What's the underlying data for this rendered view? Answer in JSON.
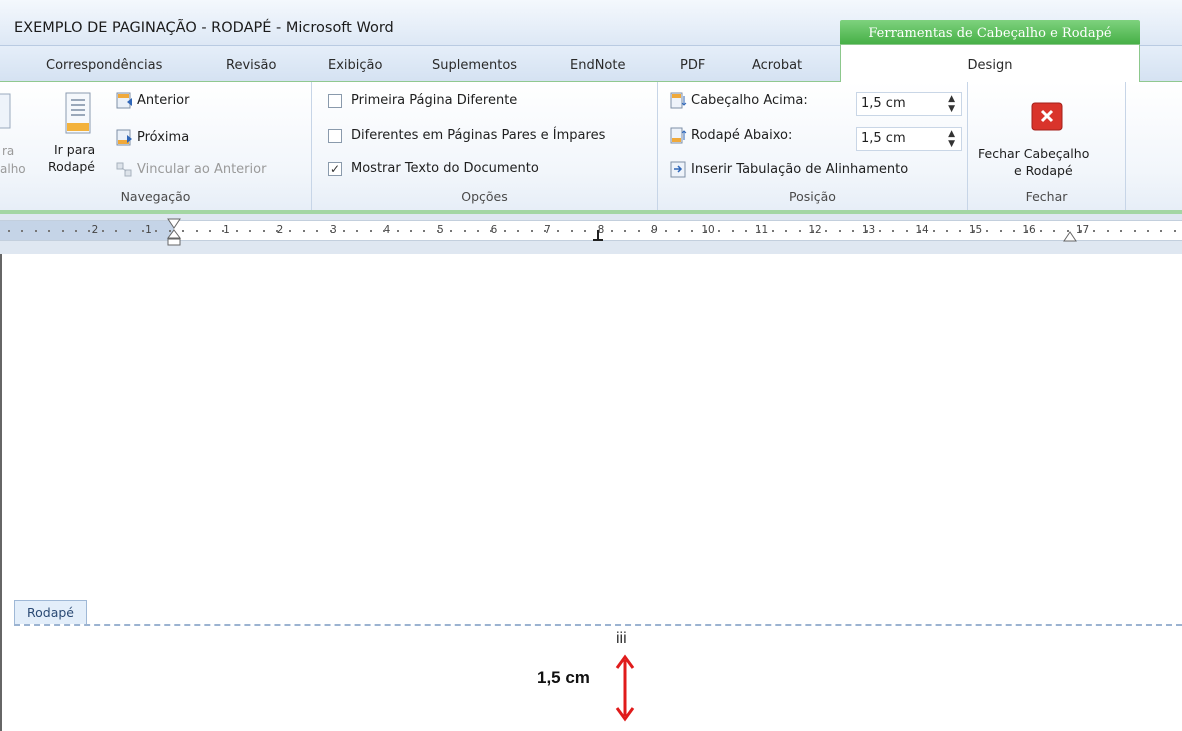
{
  "title_bar": {
    "title": "EXEMPLO DE PAGINAÇÃO - RODAPÉ  -  Microsoft Word",
    "contextual_tab": "Ferramentas de Cabeçalho e Rodapé"
  },
  "tabs": [
    "Correspondências",
    "Revisão",
    "Exibição",
    "Suplementos",
    "EndNote",
    "PDF",
    "Acrobat",
    "Design"
  ],
  "ribbon": {
    "navegacao": {
      "label": "Navegação",
      "cut_left_top": "ra",
      "cut_left_bottom": "alho",
      "goto_footer_line1": "Ir para",
      "goto_footer_line2": "Rodapé",
      "previous": "Anterior",
      "next": "Próxima",
      "link_previous": "Vincular ao Anterior"
    },
    "opcoes": {
      "label": "Opções",
      "options": [
        {
          "label": "Primeira Página Diferente",
          "checked": false
        },
        {
          "label": "Diferentes em Páginas Pares e Ímpares",
          "checked": false
        },
        {
          "label": "Mostrar Texto do Documento",
          "checked": true
        }
      ],
      "check_mark": "✓"
    },
    "posicao": {
      "label": "Posição",
      "header_from_top": "Cabeçalho Acima:",
      "header_value": "1,5 cm",
      "footer_from_bottom": "Rodapé Abaixo:",
      "footer_value": "1,5 cm",
      "insert_alignment_tab": "Inserir Tabulação de Alinhamento"
    },
    "fechar": {
      "label": "Fechar",
      "close_line1": "Fechar Cabeçalho",
      "close_line2": "e Rodapé"
    }
  },
  "ruler": {
    "left_numbers": [
      "2",
      "1"
    ],
    "numbers": [
      "1",
      "2",
      "3",
      "4",
      "5",
      "6",
      "7",
      "8",
      "9",
      "10",
      "11",
      "12",
      "13",
      "14",
      "15",
      "16",
      "17"
    ]
  },
  "document": {
    "footer_tag": "Rodapé",
    "page_number": "iii",
    "measure_label": "1,5 cm"
  },
  "colors": {
    "contextual_green": "#3daa3d",
    "close_red": "#d9342b",
    "arrow_red": "#e01b1b"
  }
}
